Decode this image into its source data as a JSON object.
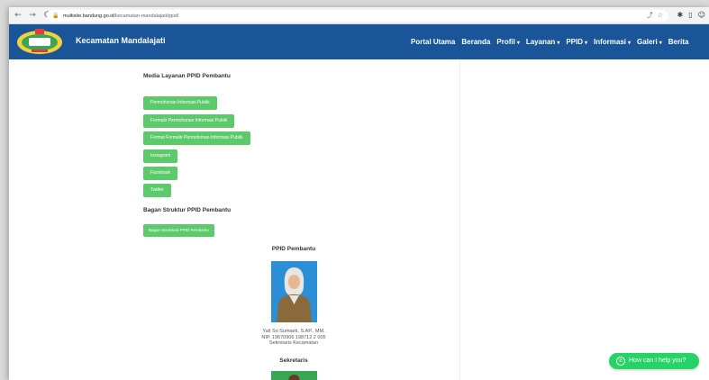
{
  "browser": {
    "url_host": "multisite.bandung.go.id",
    "url_path": "/kecamatan-mandalajati/ppid/",
    "icons": {
      "back": "arrow-left-icon",
      "forward": "arrow-right-icon",
      "reload": "reload-icon",
      "lock": "lock-icon"
    }
  },
  "header": {
    "site_title": "Kecamatan Mandalajati",
    "nav": [
      {
        "label": "Portal Utama",
        "dropdown": false
      },
      {
        "label": "Beranda",
        "dropdown": false
      },
      {
        "label": "Profil",
        "dropdown": true
      },
      {
        "label": "Layanan",
        "dropdown": true
      },
      {
        "label": "PPID",
        "dropdown": true
      },
      {
        "label": "Informasi",
        "dropdown": true
      },
      {
        "label": "Galeri",
        "dropdown": true
      },
      {
        "label": "Berita",
        "dropdown": false
      }
    ]
  },
  "main": {
    "media_heading": "Media Layanan PPID Pembantu",
    "media_buttons": [
      "Permohonan Informasi Publik",
      "Formulir Permohonan Informasi Publik",
      "Format Formulir Permohonan Informasi Publik",
      "Instagram",
      "Facebook",
      "Twitter"
    ],
    "struktur_heading": "Bagan Struktur PPID Pembantu",
    "struktur_button": "Bagan Struktural PPID Pembantu",
    "ppid_heading": "PPID Pembantu",
    "person": {
      "name": "Yati Sri Sumiarti, S.AP., MM.",
      "nip": "NIP. 19670906 198712 2 005",
      "role": "Sekretaris Kecamatan"
    },
    "sekretaris_heading": "Sekretaris"
  },
  "chat": {
    "label": "How can I help you?"
  },
  "colors": {
    "header_bg": "#1a5599",
    "button_green": "#5cc96a",
    "whatsapp_green": "#25d366"
  }
}
